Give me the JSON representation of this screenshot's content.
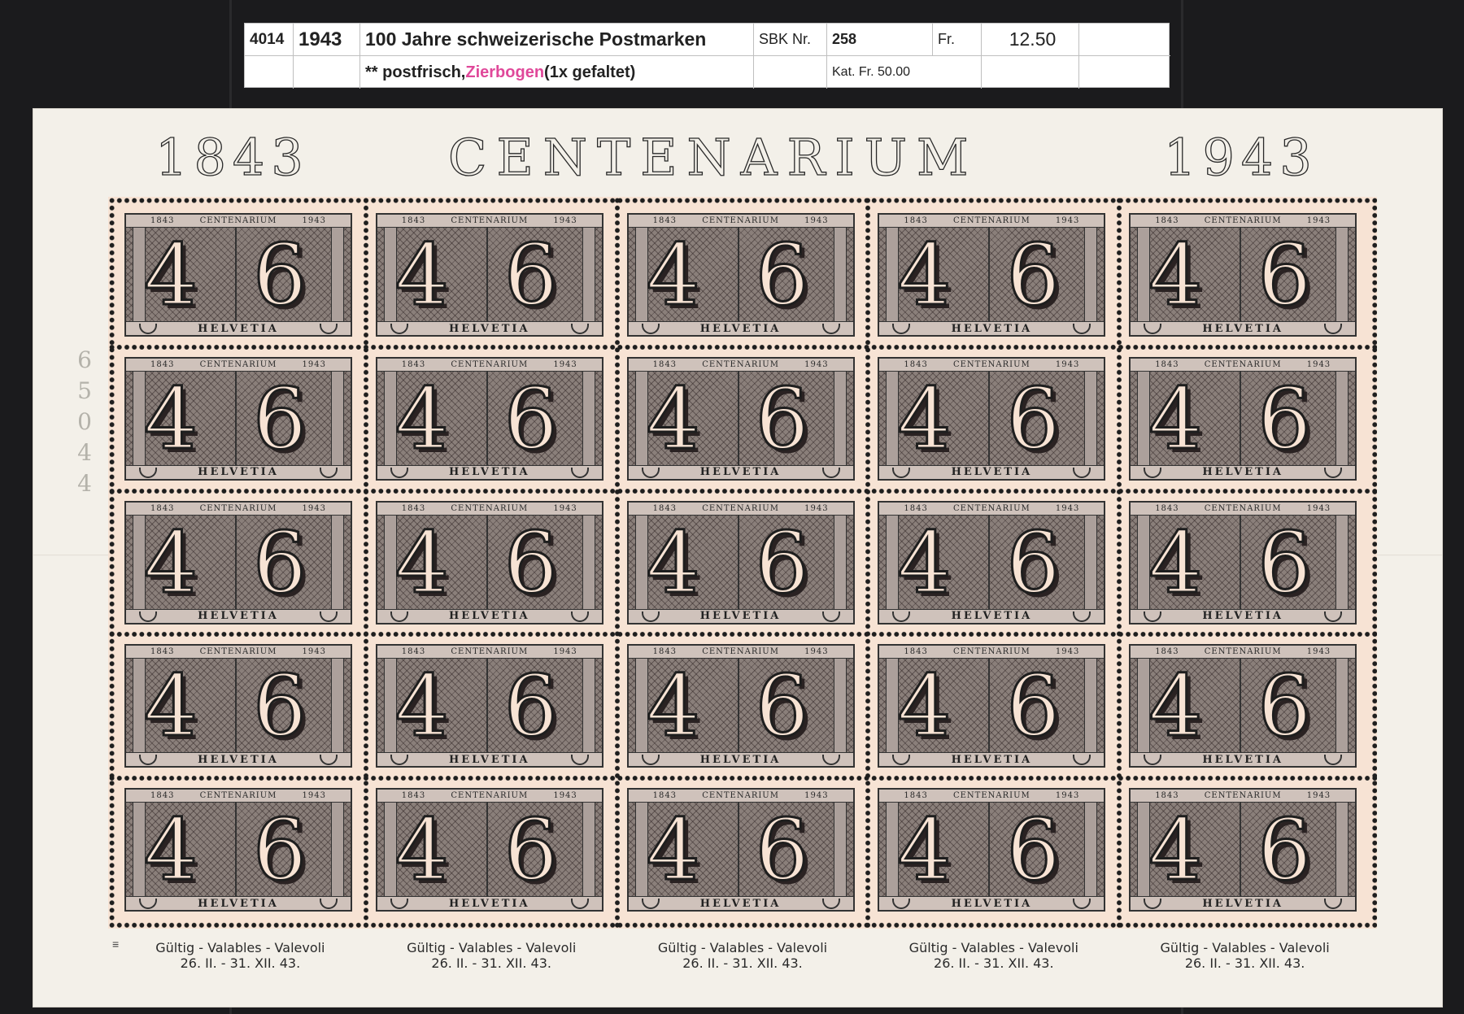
{
  "label": {
    "lot_number": "4014",
    "year": "1943",
    "title": "100 Jahre schweizerische Postmarken",
    "catalog_label": "SBK Nr.",
    "catalog_number": "258",
    "currency": "Fr.",
    "price": "12.50",
    "condition_prefix": "** postfrisch, ",
    "condition_highlight": "Zierbogen",
    "condition_suffix": " (1x gefaltet)",
    "catalog_value": "Kat. Fr. 50.00"
  },
  "sheet": {
    "header_left": "1843",
    "header_center": "CENTENARIUM",
    "header_right": "1943",
    "sheet_number": "65044",
    "rows": 5,
    "columns": 5,
    "stamp": {
      "top_left": "1843",
      "top_center": "CENTENARIUM",
      "top_right": "1943",
      "numeral_left": "4",
      "numeral_right": "6",
      "country": "HELVETIA"
    },
    "captions": [
      {
        "line1": "Gültig - Valables - Valevoli",
        "line2": "26. II. - 31. XII. 43."
      },
      {
        "line1": "Gültig - Valables - Valevoli",
        "line2": "26. II. - 31. XII. 43."
      },
      {
        "line1": "Gültig - Valables - Valevoli",
        "line2": "26. II. - 31. XII. 43."
      },
      {
        "line1": "Gültig - Valables - Valevoli",
        "line2": "26. II. - 31. XII. 43."
      },
      {
        "line1": "Gültig - Valables - Valevoli",
        "line2": "26. II. - 31. XII. 43."
      }
    ]
  },
  "colors": {
    "background": "#1b1b1d",
    "sheet_paper": "#f3f0e9",
    "stamp_paper": "#f7e3d4",
    "stamp_ink": "#8a7f7a",
    "price_accent": "#e0489a"
  }
}
